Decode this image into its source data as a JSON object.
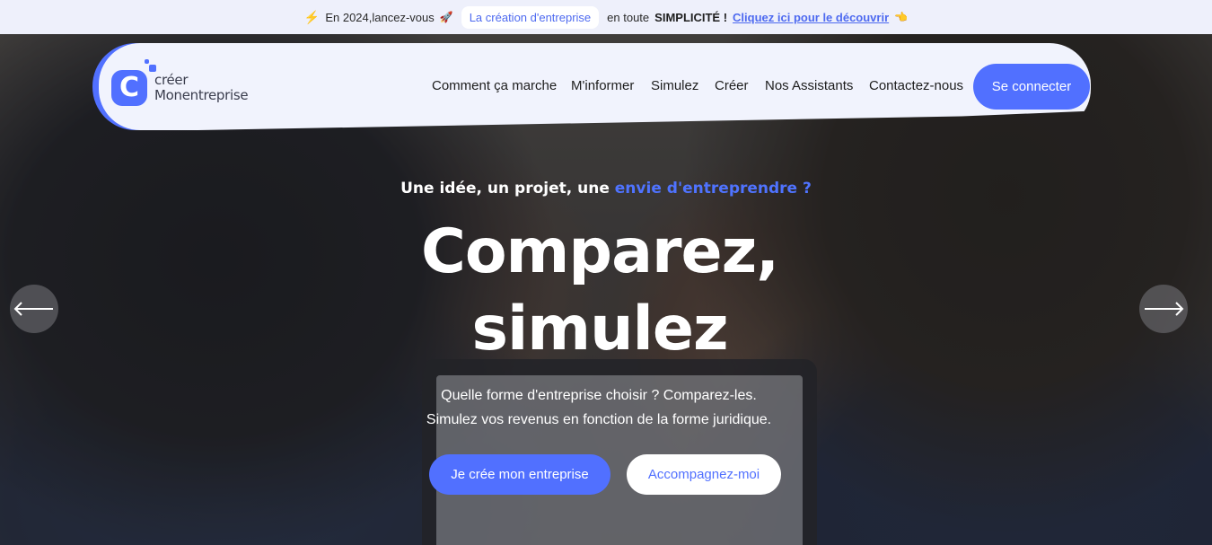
{
  "announcement": {
    "lead": "En 2024,lancez-vous",
    "pill": "La création d'entreprise",
    "middle": "en toute",
    "emphasis": "SIMPLICITÉ !",
    "link": "Cliquez ici pour le découvrir"
  },
  "brand": {
    "mark": "C",
    "line1": "créer",
    "line2": "Monentreprise"
  },
  "nav": {
    "items": [
      "Comment ça marche",
      "M'informer",
      "Simulez",
      "Créer",
      "Nos Assistants",
      "Contactez-nous"
    ],
    "login": "Se connecter"
  },
  "hero": {
    "tagline_plain": "Une idée, un projet, une",
    "tagline_accent": "envie d'entreprendre ?",
    "headline_line1": "Comparez,",
    "headline_line2": "simulez",
    "desc_line1": "Quelle forme d'entreprise choisir ? Comparez-les.",
    "desc_line2": "Simulez vos revenus en fonction de la forme juridique.",
    "cta_primary": "Je crée mon entreprise",
    "cta_secondary": "Accompagnez-moi"
  },
  "colors": {
    "accent": "#5170ff",
    "announce_bg": "#eef0fb",
    "nav_bg": "#f1f3fd"
  },
  "icons": {
    "prev": "arrow-left-icon",
    "next": "arrow-right-icon",
    "bolt": "lightning-icon",
    "rocket": "rocket-icon",
    "hand": "pointing-hand-icon"
  }
}
